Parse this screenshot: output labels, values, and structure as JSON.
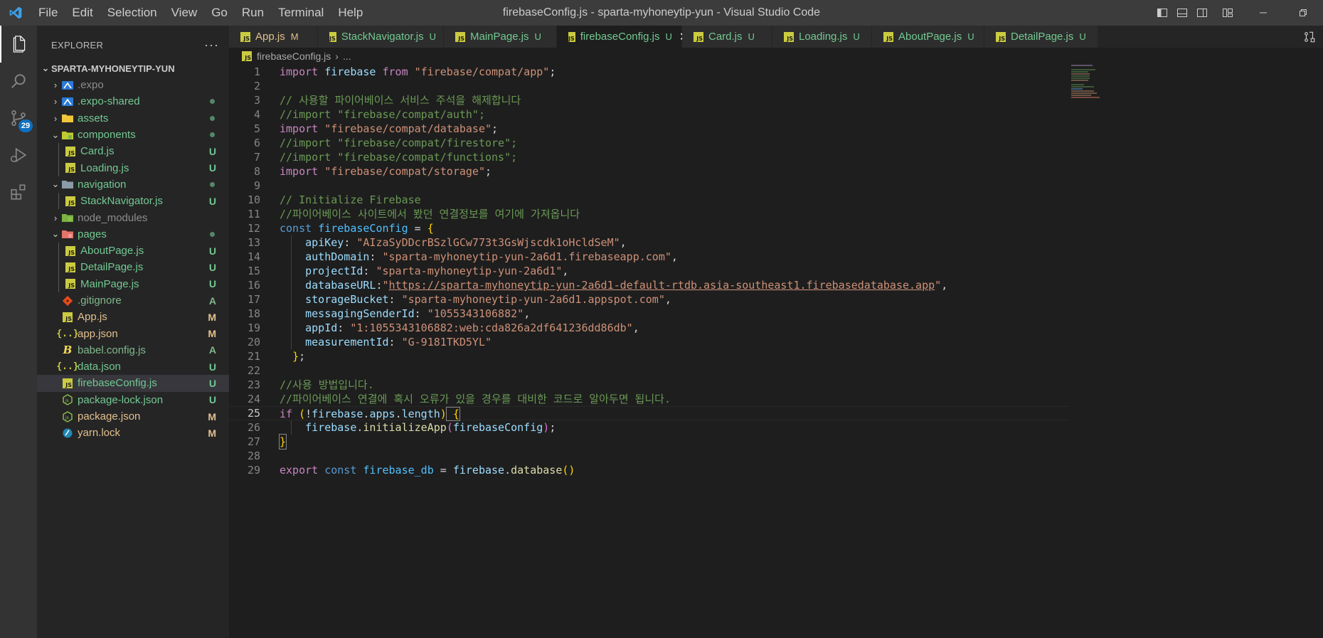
{
  "window": {
    "title": "firebaseConfig.js - sparta-myhoneytip-yun - Visual Studio Code",
    "menu": [
      "File",
      "Edit",
      "Selection",
      "View",
      "Go",
      "Run",
      "Terminal",
      "Help"
    ]
  },
  "activity_bar": {
    "source_control_badge": "29"
  },
  "sidebar": {
    "title": "EXPLORER",
    "more": "···",
    "folder": "SPARTA-MYHONEYTIP-YUN",
    "items": [
      {
        "label": ".expo",
        "status": ""
      },
      {
        "label": ".expo-shared",
        "status": ""
      },
      {
        "label": "assets",
        "status": ""
      },
      {
        "label": "components",
        "status": ""
      },
      {
        "label": "Card.js",
        "status": "U"
      },
      {
        "label": "Loading.js",
        "status": "U"
      },
      {
        "label": "navigation",
        "status": ""
      },
      {
        "label": "StackNavigator.js",
        "status": "U"
      },
      {
        "label": "node_modules",
        "status": ""
      },
      {
        "label": "pages",
        "status": ""
      },
      {
        "label": "AboutPage.js",
        "status": "U"
      },
      {
        "label": "DetailPage.js",
        "status": "U"
      },
      {
        "label": "MainPage.js",
        "status": "U"
      },
      {
        "label": ".gitignore",
        "status": "A"
      },
      {
        "label": "App.js",
        "status": "M"
      },
      {
        "label": "app.json",
        "status": "M"
      },
      {
        "label": "babel.config.js",
        "status": "A"
      },
      {
        "label": "data.json",
        "status": "U"
      },
      {
        "label": "firebaseConfig.js",
        "status": "U"
      },
      {
        "label": "package-lock.json",
        "status": "U"
      },
      {
        "label": "package.json",
        "status": "M"
      },
      {
        "label": "yarn.lock",
        "status": "M"
      }
    ]
  },
  "tabs": [
    {
      "label": "App.js",
      "status": "M"
    },
    {
      "label": "StackNavigator.js",
      "status": "U"
    },
    {
      "label": "MainPage.js",
      "status": "U"
    },
    {
      "label": "firebaseConfig.js",
      "status": "U",
      "close": "✕"
    },
    {
      "label": "Card.js",
      "status": "U"
    },
    {
      "label": "Loading.js",
      "status": "U"
    },
    {
      "label": "AboutPage.js",
      "status": "U"
    },
    {
      "label": "DetailPage.js",
      "status": "U"
    }
  ],
  "breadcrumb": {
    "file": "firebaseConfig.js",
    "sep": "›",
    "rest": "..."
  },
  "editor": {
    "line_numbers": [
      "1",
      "2",
      "3",
      "4",
      "5",
      "6",
      "7",
      "8",
      "9",
      "10",
      "11",
      "12",
      "13",
      "14",
      "15",
      "16",
      "17",
      "18",
      "19",
      "20",
      "21",
      "22",
      "23",
      "24",
      "25",
      "26",
      "27",
      "28",
      "29"
    ],
    "l1": {
      "kw_import": "import",
      "name": "firebase",
      "kw_from": "from",
      "str": "\"firebase/compat/app\"",
      "semi": ";"
    },
    "l3": "// 사용할 파이어베이스 서비스 주석을 해제합니다",
    "l4": "//import \"firebase/compat/auth\";",
    "l5": {
      "kw": "import",
      "str": "\"firebase/compat/database\"",
      "semi": ";"
    },
    "l6": "//import \"firebase/compat/firestore\";",
    "l7": "//import \"firebase/compat/functions\";",
    "l8": {
      "kw": "import",
      "str": "\"firebase/compat/storage\"",
      "semi": ";"
    },
    "l10": "// Initialize Firebase",
    "l11": "//파이어베이스 사이트에서 봤던 연결정보를 여기에 가져옵니다",
    "l12": {
      "kw": "const",
      "name": "firebaseConfig",
      "eq": " = ",
      "brace": "{"
    },
    "config": [
      {
        "key": "apiKey",
        "value": "\"AIzaSyDDcrBSzlGCw773t3GsWjscdk1oHcldSeM\"",
        "end": ","
      },
      {
        "key": "authDomain",
        "value": "\"sparta-myhoneytip-yun-2a6d1.firebaseapp.com\"",
        "end": ","
      },
      {
        "key": "projectId",
        "value": "\"sparta-myhoneytip-yun-2a6d1\"",
        "end": ","
      },
      {
        "key": "databaseURL",
        "value": "https://sparta-myhoneytip-yun-2a6d1-default-rtdb.asia-southeast1.firebasedatabase.app",
        "end": ","
      },
      {
        "key": "storageBucket",
        "value": "\"sparta-myhoneytip-yun-2a6d1.appspot.com\"",
        "end": ","
      },
      {
        "key": "messagingSenderId",
        "value": "\"1055343106882\"",
        "end": ","
      },
      {
        "key": "appId",
        "value": "\"1:1055343106882:web:cda826a2df641236dd86db\"",
        "end": ","
      },
      {
        "key": "measurementId",
        "value": "\"G-9181TKD5YL\"",
        "end": ""
      }
    ],
    "l21": {
      "brace": "}",
      "semi": ";"
    },
    "l23": "//사용 방법입니다.",
    "l24": "//파이어베이스 연결에 혹시 오류가 있을 경우를 대비한 코드로 알아두면 됩니다.",
    "l25": {
      "kw": "if",
      "open": " (",
      "bang": "!",
      "obj": "firebase",
      "dot1": ".",
      "prop1": "apps",
      "dot2": ".",
      "prop2": "length",
      "close": ")",
      "brace": " {"
    },
    "l26": {
      "obj": "firebase",
      "dot": ".",
      "fn": "initializeApp",
      "open": "(",
      "arg": "firebaseConfig",
      "close": ")",
      "semi": ";"
    },
    "l27": "}",
    "l29": {
      "kw_export": "export",
      "kw_const": "const",
      "name": "firebase_db",
      "eq": " = ",
      "obj": "firebase",
      "dot": ".",
      "fn": "database",
      "parens": "()"
    }
  }
}
